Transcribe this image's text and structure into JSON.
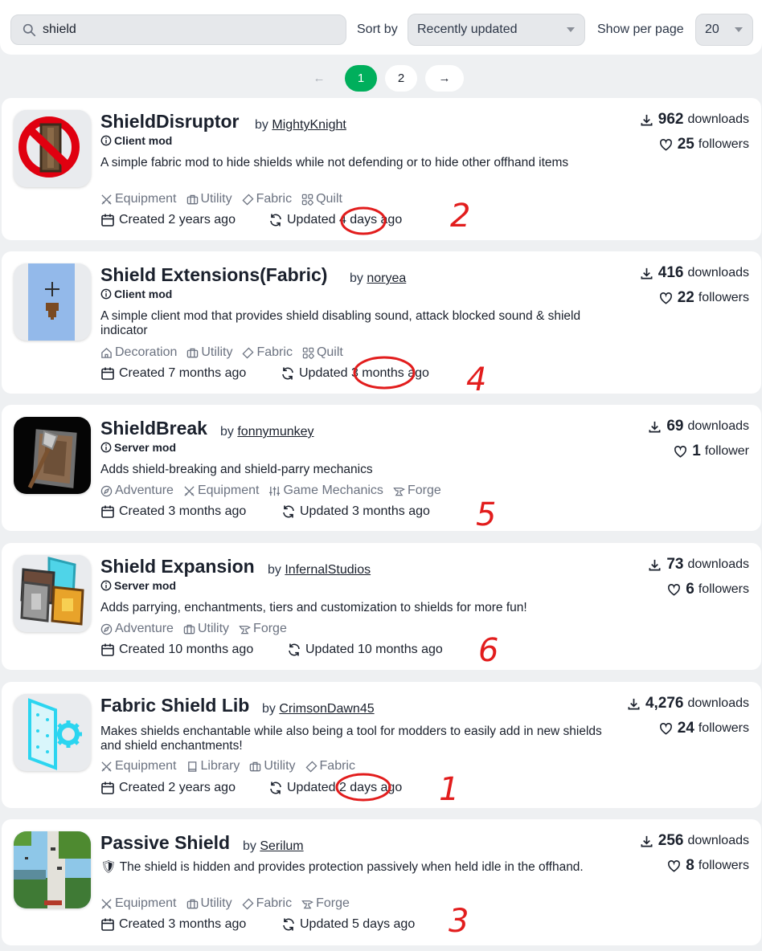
{
  "filters": {
    "search_value": "shield",
    "sort_label": "Sort by",
    "sort_value": "Recently updated",
    "per_page_label": "Show per page",
    "per_page_value": "20"
  },
  "pagination": {
    "prev": "←",
    "page1": "1",
    "page2": "2",
    "next": "→"
  },
  "projects": [
    {
      "title": "ShieldDisruptor",
      "by": "by",
      "author": "MightyKnight",
      "env": "Client mod",
      "description": "A simple fabric mod to hide shields while not defending or to hide other offhand items",
      "tags": [
        "Equipment",
        "Utility",
        "Fabric",
        "Quilt"
      ],
      "created": "Created 2 years ago",
      "updated": "Updated 4 days ago",
      "downloads": "962",
      "downloads_label": "downloads",
      "followers": "25",
      "followers_label": "followers"
    },
    {
      "title": "Shield Extensions(Fabric)",
      "by": "by",
      "author": "noryea",
      "env": "Client mod",
      "description": "A simple client mod that provides shield disabling sound, attack blocked sound & shield indicator",
      "tags": [
        "Decoration",
        "Utility",
        "Fabric",
        "Quilt"
      ],
      "created": "Created 7 months ago",
      "updated": "Updated 3 months ago",
      "downloads": "416",
      "downloads_label": "downloads",
      "followers": "22",
      "followers_label": "followers"
    },
    {
      "title": "ShieldBreak",
      "by": "by",
      "author": "fonnymunkey",
      "env": "Server mod",
      "description": "Adds shield-breaking and shield-parry mechanics",
      "tags": [
        "Adventure",
        "Equipment",
        "Game Mechanics",
        "Forge"
      ],
      "created": "Created 3 months ago",
      "updated": "Updated 3 months ago",
      "downloads": "69",
      "downloads_label": "downloads",
      "followers": "1",
      "followers_label": "follower"
    },
    {
      "title": "Shield Expansion",
      "by": "by",
      "author": "InfernalStudios",
      "env": "Server mod",
      "description": "Adds parrying, enchantments, tiers and customization to shields for more fun!",
      "tags": [
        "Adventure",
        "Utility",
        "Forge"
      ],
      "created": "Created 10 months ago",
      "updated": "Updated 10 months ago",
      "downloads": "73",
      "downloads_label": "downloads",
      "followers": "6",
      "followers_label": "followers"
    },
    {
      "title": "Fabric Shield Lib",
      "by": "by",
      "author": "CrimsonDawn45",
      "env": "",
      "description": "Makes shields enchantable while also being a tool for modders to easily add in new shields and shield enchantments!",
      "tags": [
        "Equipment",
        "Library",
        "Utility",
        "Fabric"
      ],
      "created": "Created 2 years ago",
      "updated": "Updated 2 days ago",
      "downloads": "4,276",
      "downloads_label": "downloads",
      "followers": "24",
      "followers_label": "followers"
    },
    {
      "title": "Passive Shield",
      "by": "by",
      "author": "Serilum",
      "env": "",
      "description": "🛡 The shield is hidden and provides protection passively when held idle in the offhand.",
      "tags": [
        "Equipment",
        "Utility",
        "Fabric",
        "Forge"
      ],
      "created": "Created 3 months ago",
      "updated": "Updated 5 days ago",
      "downloads": "256",
      "downloads_label": "downloads",
      "followers": "8",
      "followers_label": "followers"
    }
  ],
  "annotations": {
    "n1": "1",
    "n2": "2",
    "n3": "3",
    "n4": "4",
    "n5": "5",
    "n6": "6"
  },
  "colors": {
    "brand_green": "#00af5c",
    "annotation_red": "#e21d1d",
    "background": "#eef0f2"
  }
}
